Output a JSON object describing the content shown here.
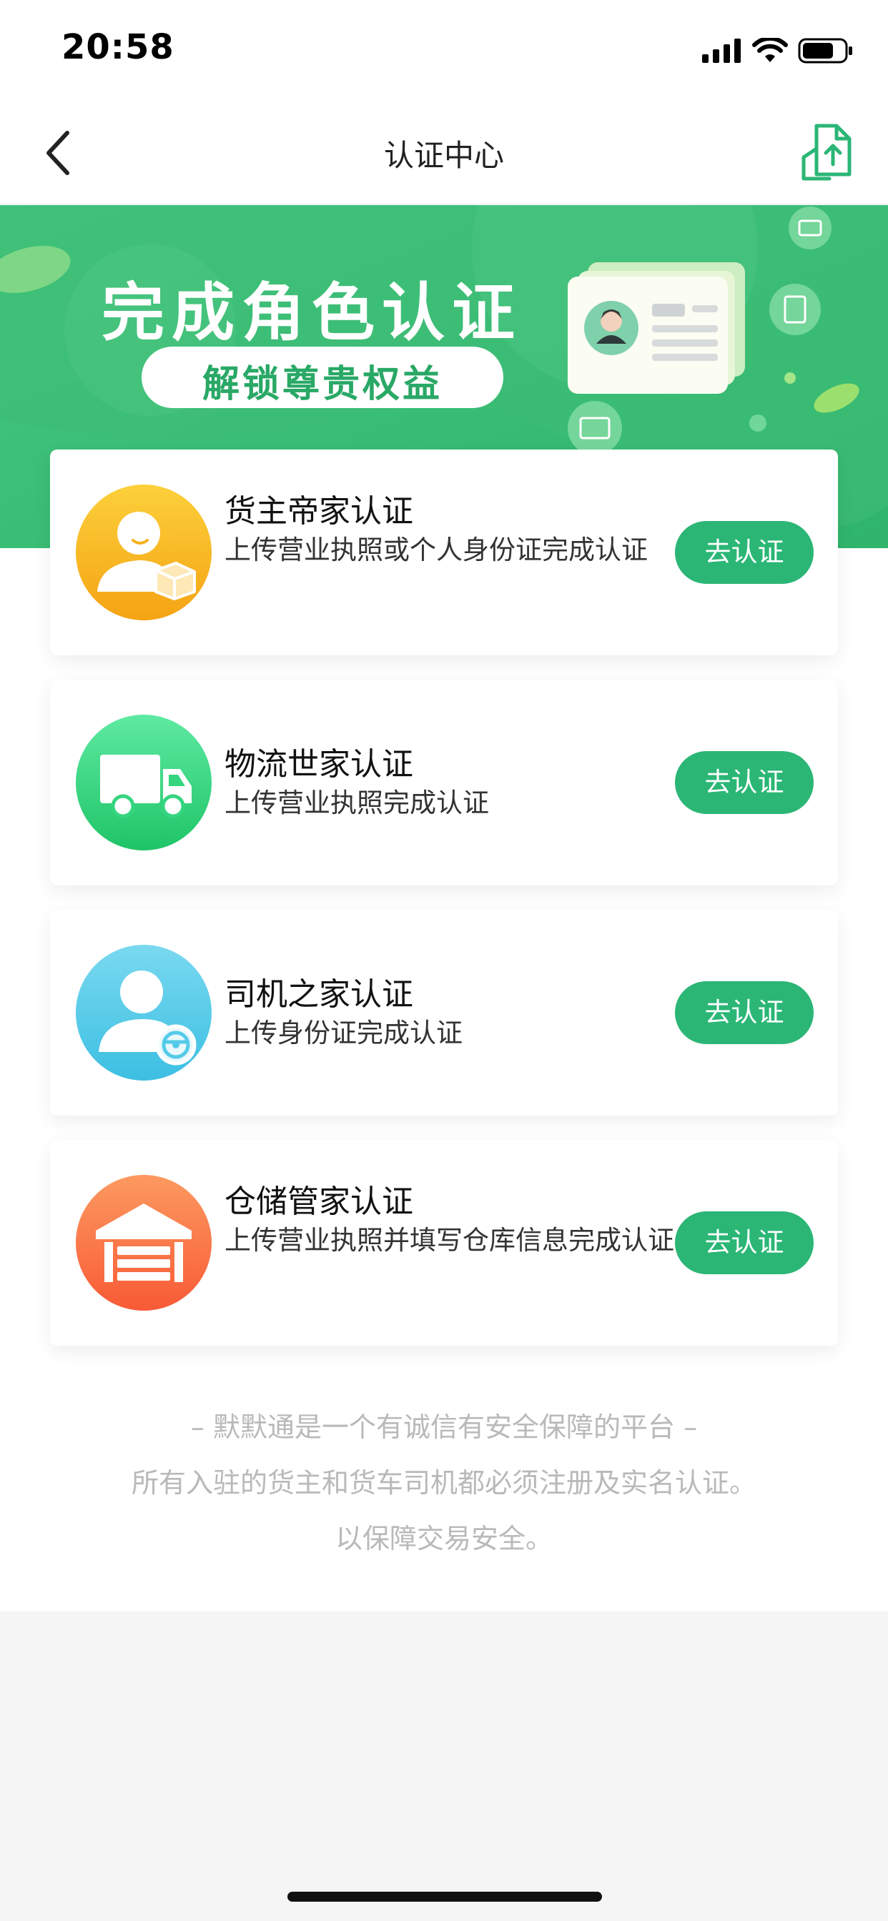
{
  "status_bar": {
    "time": "20:58"
  },
  "navbar": {
    "title": "认证中心"
  },
  "banner": {
    "title": "完成角色认证",
    "subtitle": "解锁尊贵权益"
  },
  "cards": [
    {
      "title": "货主帝家认证",
      "desc": "上传营业执照或个人身份证完成认证",
      "button": "去认证",
      "color": "#f5b21f",
      "icon": "cargo-owner-icon"
    },
    {
      "title": "物流世家认证",
      "desc": "上传营业执照完成认证",
      "button": "去认证",
      "color": "#35d57f",
      "icon": "truck-icon"
    },
    {
      "title": "司机之家认证",
      "desc": "上传身份证完成认证",
      "button": "去认证",
      "color": "#53cbe8",
      "icon": "driver-icon"
    },
    {
      "title": "仓储管家认证",
      "desc": "上传营业执照并填写仓库信息完成认证",
      "button": "去认证",
      "color": "#fb7a45",
      "icon": "warehouse-icon"
    }
  ],
  "footer": {
    "line1": "– 默默通是一个有诚信有安全保障的平台 –",
    "line2": "所有入驻的货主和货车司机都必须注册及实名认证。",
    "line3": "以保障交易安全。"
  },
  "colors": {
    "brand_green": "#2bb676",
    "banner_green": "#3cc07a"
  }
}
